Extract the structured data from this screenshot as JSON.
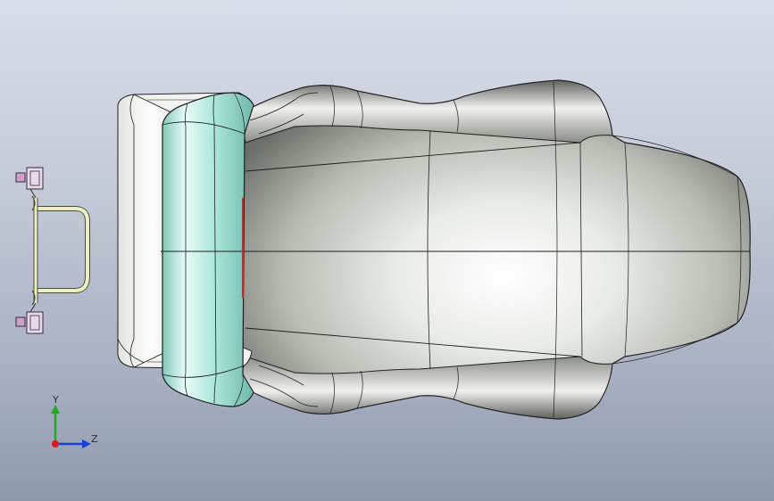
{
  "viewport": {
    "background_top": "#d8dee8",
    "background_bottom": "#8f99ad"
  },
  "model": {
    "parts": [
      "seat-shell",
      "headrest",
      "mount-bracket"
    ],
    "headrest_color": "#aee8dc",
    "shell_color": "#eef0ee",
    "edge_color": "#1e1e1e",
    "bracket_color": "#ecefc4",
    "fastener_color": "#c9a3c9"
  },
  "triad": {
    "y_label": "Y",
    "z_label": "Z",
    "y_color": "#22aa22",
    "z_color": "#1a3fd8",
    "x_color": "#e01818"
  }
}
